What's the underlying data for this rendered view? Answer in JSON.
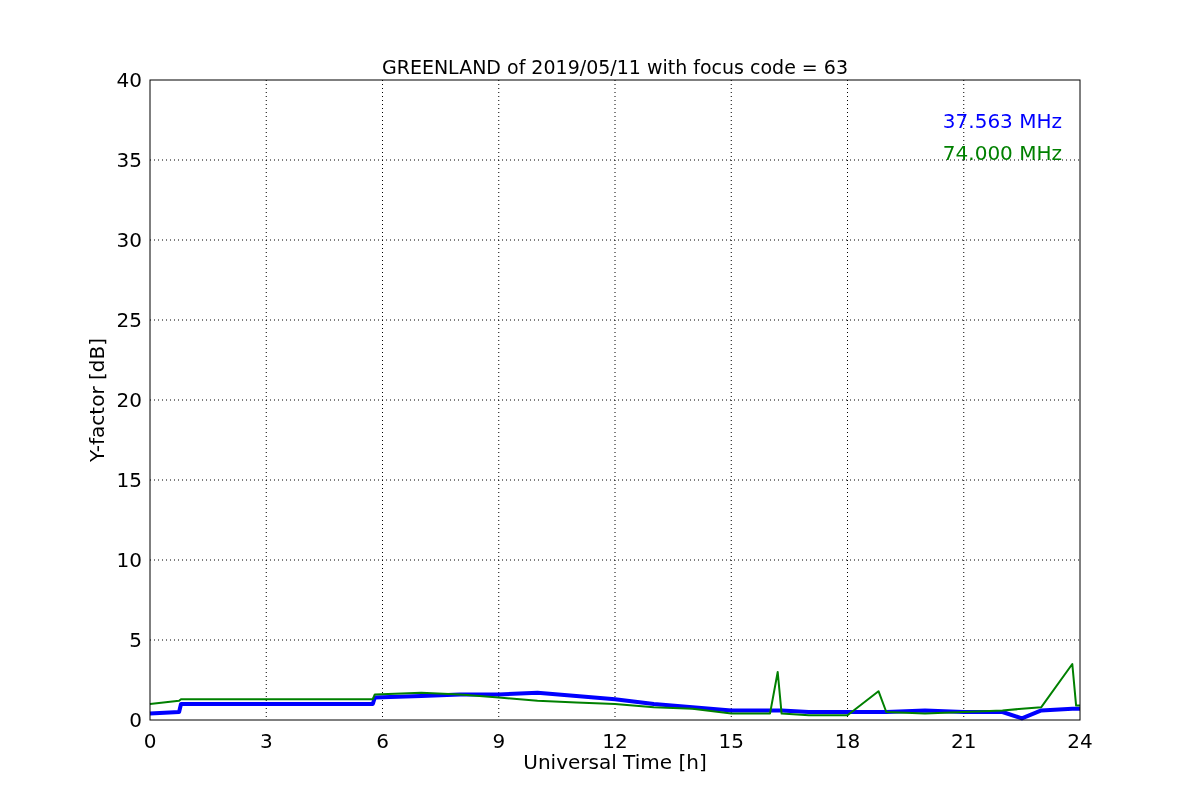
{
  "figure": {
    "chart_data": {
      "type": "line",
      "title": "GREENLAND of 2019/05/11 with focus code = 63",
      "xlabel": "Universal Time [h]",
      "ylabel": "Y-factor [dB]",
      "x": [
        0,
        0.75,
        0.8,
        5.75,
        5.8,
        7,
        8,
        9,
        10,
        11,
        12,
        13,
        14,
        15,
        16,
        16.2,
        16.3,
        17,
        18,
        18.8,
        19,
        20,
        21,
        22,
        22.5,
        23,
        23.8,
        23.9,
        24
      ],
      "series": [
        {
          "name": "37.563 MHz",
          "color": "#0000ff",
          "values": [
            0.4,
            0.5,
            1.0,
            1.0,
            1.4,
            1.5,
            1.6,
            1.6,
            1.7,
            1.5,
            1.3,
            1.0,
            0.8,
            0.6,
            0.6,
            0.6,
            0.6,
            0.5,
            0.5,
            0.5,
            0.5,
            0.6,
            0.5,
            0.5,
            0.1,
            0.6,
            0.7,
            0.7,
            0.7
          ]
        },
        {
          "name": "74.000 MHz",
          "color": "#008000",
          "values": [
            1.0,
            1.2,
            1.3,
            1.3,
            1.6,
            1.7,
            1.6,
            1.4,
            1.2,
            1.1,
            1.0,
            0.8,
            0.7,
            0.4,
            0.4,
            3.0,
            0.4,
            0.3,
            0.3,
            1.8,
            0.5,
            0.4,
            0.5,
            0.6,
            0.7,
            0.8,
            3.5,
            0.9,
            0.9
          ]
        }
      ],
      "xlim": [
        0,
        24
      ],
      "ylim": [
        0,
        40
      ],
      "xticks": [
        0,
        3,
        6,
        9,
        12,
        15,
        18,
        21,
        24
      ],
      "yticks": [
        0,
        5,
        10,
        15,
        20,
        25,
        30,
        35,
        40
      ],
      "grid": true
    }
  }
}
